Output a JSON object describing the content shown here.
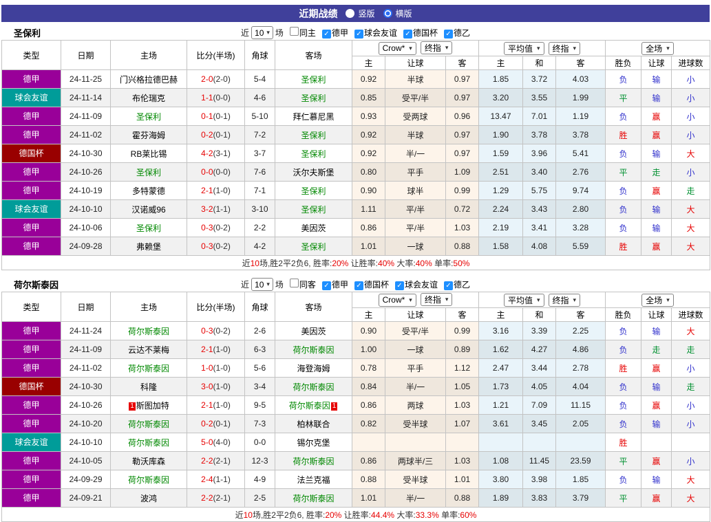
{
  "top_bar": {
    "title": "近期战绩",
    "radios": [
      {
        "label": "竖版",
        "selected": false
      },
      {
        "label": "横版",
        "selected": true
      }
    ]
  },
  "header": {
    "static_cols": [
      "类型",
      "日期",
      "主场",
      "比分(半场)",
      "角球",
      "客场"
    ],
    "group1_selects": [
      "Crow*",
      "终指"
    ],
    "group2_selects": [
      "平均值",
      "终指"
    ],
    "group3_selects": [
      "全场"
    ],
    "sub_cols": [
      "主",
      "让球",
      "客",
      "主",
      "和",
      "客",
      "胜负",
      "让球",
      "进球数"
    ],
    "caret": "▾",
    "check_glyph": "✓"
  },
  "colors": {
    "topbar": "#40409b",
    "league": {
      "purple": "#990099",
      "teal": "#009c99",
      "darkred": "#990000"
    },
    "team_green": "#008800",
    "score_red": "#e60000",
    "result": {
      "r": "#e60000",
      "b": "#3030cc",
      "g": "#009030"
    },
    "crow_bg": "#fdf4ea",
    "avg_bg": "#e9f4fa",
    "checkbox_blue": "#1e8fff",
    "radio_blue": "#2a6df4",
    "card_red": "#e60000"
  },
  "tables": [
    {
      "team": "圣保利",
      "filter": {
        "near_label": "近",
        "count": "10",
        "games_label": "场",
        "same_label": "同主",
        "same_checked": false,
        "leagues": [
          {
            "label": "德甲",
            "checked": true
          },
          {
            "label": "球会友谊",
            "checked": true
          },
          {
            "label": "德国杯",
            "checked": true
          },
          {
            "label": "德乙",
            "checked": true
          }
        ]
      },
      "rows": [
        {
          "league": "德甲",
          "lc": "purple",
          "date": "24-11-25",
          "home": "门兴格拉德巴赫",
          "home_team": false,
          "home_card": false,
          "score": "2-0",
          "half": "(2-0)",
          "corner": "5-4",
          "away": "圣保利",
          "away_team": true,
          "away_card": false,
          "odds": [
            "0.92",
            "半球",
            "0.97",
            "1.85",
            "3.72",
            "4.03"
          ],
          "res": [
            [
              "负",
              "b"
            ],
            [
              "输",
              "b"
            ],
            [
              "小",
              "b"
            ]
          ]
        },
        {
          "league": "球会友谊",
          "lc": "teal",
          "date": "24-11-14",
          "home": "布伦瑞克",
          "home_team": false,
          "home_card": false,
          "score": "1-1",
          "half": "(0-0)",
          "corner": "4-6",
          "away": "圣保利",
          "away_team": true,
          "away_card": false,
          "odds": [
            "0.85",
            "受平/半",
            "0.97",
            "3.20",
            "3.55",
            "1.99"
          ],
          "res": [
            [
              "平",
              "g"
            ],
            [
              "输",
              "b"
            ],
            [
              "小",
              "b"
            ]
          ]
        },
        {
          "league": "德甲",
          "lc": "purple",
          "date": "24-11-09",
          "home": "圣保利",
          "home_team": true,
          "home_card": false,
          "score": "0-1",
          "half": "(0-1)",
          "corner": "5-10",
          "away": "拜仁慕尼黑",
          "away_team": false,
          "away_card": false,
          "odds": [
            "0.93",
            "受两球",
            "0.96",
            "13.47",
            "7.01",
            "1.19"
          ],
          "res": [
            [
              "负",
              "b"
            ],
            [
              "赢",
              "r"
            ],
            [
              "小",
              "b"
            ]
          ]
        },
        {
          "league": "德甲",
          "lc": "purple",
          "date": "24-11-02",
          "home": "霍芬海姆",
          "home_team": false,
          "home_card": false,
          "score": "0-2",
          "half": "(0-1)",
          "corner": "7-2",
          "away": "圣保利",
          "away_team": true,
          "away_card": false,
          "odds": [
            "0.92",
            "半球",
            "0.97",
            "1.90",
            "3.78",
            "3.78"
          ],
          "res": [
            [
              "胜",
              "r"
            ],
            [
              "赢",
              "r"
            ],
            [
              "小",
              "b"
            ]
          ]
        },
        {
          "league": "德国杯",
          "lc": "darkred",
          "date": "24-10-30",
          "home": "RB莱比锡",
          "home_team": false,
          "home_card": false,
          "score": "4-2",
          "half": "(3-1)",
          "corner": "3-7",
          "away": "圣保利",
          "away_team": true,
          "away_card": false,
          "odds": [
            "0.92",
            "半/一",
            "0.97",
            "1.59",
            "3.96",
            "5.41"
          ],
          "res": [
            [
              "负",
              "b"
            ],
            [
              "输",
              "b"
            ],
            [
              "大",
              "r"
            ]
          ]
        },
        {
          "league": "德甲",
          "lc": "purple",
          "date": "24-10-26",
          "home": "圣保利",
          "home_team": true,
          "home_card": false,
          "score": "0-0",
          "half": "(0-0)",
          "corner": "7-6",
          "away": "沃尔夫斯堡",
          "away_team": false,
          "away_card": false,
          "odds": [
            "0.80",
            "平手",
            "1.09",
            "2.51",
            "3.40",
            "2.76"
          ],
          "res": [
            [
              "平",
              "g"
            ],
            [
              "走",
              "g"
            ],
            [
              "小",
              "b"
            ]
          ]
        },
        {
          "league": "德甲",
          "lc": "purple",
          "date": "24-10-19",
          "home": "多特蒙德",
          "home_team": false,
          "home_card": false,
          "score": "2-1",
          "half": "(1-0)",
          "corner": "7-1",
          "away": "圣保利",
          "away_team": true,
          "away_card": false,
          "odds": [
            "0.90",
            "球半",
            "0.99",
            "1.29",
            "5.75",
            "9.74"
          ],
          "res": [
            [
              "负",
              "b"
            ],
            [
              "赢",
              "r"
            ],
            [
              "走",
              "g"
            ]
          ]
        },
        {
          "league": "球会友谊",
          "lc": "teal",
          "date": "24-10-10",
          "home": "汉诺威96",
          "home_team": false,
          "home_card": false,
          "score": "3-2",
          "half": "(1-1)",
          "corner": "3-10",
          "away": "圣保利",
          "away_team": true,
          "away_card": false,
          "odds": [
            "1.11",
            "平/半",
            "0.72",
            "2.24",
            "3.43",
            "2.80"
          ],
          "res": [
            [
              "负",
              "b"
            ],
            [
              "输",
              "b"
            ],
            [
              "大",
              "r"
            ]
          ]
        },
        {
          "league": "德甲",
          "lc": "purple",
          "date": "24-10-06",
          "home": "圣保利",
          "home_team": true,
          "home_card": false,
          "score": "0-3",
          "half": "(0-2)",
          "corner": "2-2",
          "away": "美因茨",
          "away_team": false,
          "away_card": false,
          "odds": [
            "0.86",
            "平/半",
            "1.03",
            "2.19",
            "3.41",
            "3.28"
          ],
          "res": [
            [
              "负",
              "b"
            ],
            [
              "输",
              "b"
            ],
            [
              "大",
              "r"
            ]
          ]
        },
        {
          "league": "德甲",
          "lc": "purple",
          "date": "24-09-28",
          "home": "弗赖堡",
          "home_team": false,
          "home_card": false,
          "score": "0-3",
          "half": "(0-2)",
          "corner": "4-2",
          "away": "圣保利",
          "away_team": true,
          "away_card": false,
          "odds": [
            "1.01",
            "一球",
            "0.88",
            "1.58",
            "4.08",
            "5.59"
          ],
          "res": [
            [
              "胜",
              "r"
            ],
            [
              "赢",
              "r"
            ],
            [
              "大",
              "r"
            ]
          ]
        }
      ],
      "footer": [
        {
          "t": "近"
        },
        {
          "t": "10",
          "r": 1
        },
        {
          "t": "场,胜2平2负6, 胜率:"
        },
        {
          "t": "20%",
          "r": 1
        },
        {
          "t": " 让胜率:"
        },
        {
          "t": "40%",
          "r": 1
        },
        {
          "t": " 大率:"
        },
        {
          "t": "40%",
          "r": 1
        },
        {
          "t": " 单率:"
        },
        {
          "t": "50%",
          "r": 1
        }
      ]
    },
    {
      "team": "荷尔斯泰因",
      "filter": {
        "near_label": "近",
        "count": "10",
        "games_label": "场",
        "same_label": "同客",
        "same_checked": false,
        "leagues": [
          {
            "label": "德甲",
            "checked": true
          },
          {
            "label": "德国杯",
            "checked": true
          },
          {
            "label": "球会友谊",
            "checked": true
          },
          {
            "label": "德乙",
            "checked": true
          }
        ]
      },
      "rows": [
        {
          "league": "德甲",
          "lc": "purple",
          "date": "24-11-24",
          "home": "荷尔斯泰因",
          "home_team": true,
          "home_card": false,
          "score": "0-3",
          "half": "(0-2)",
          "corner": "2-6",
          "away": "美因茨",
          "away_team": false,
          "away_card": false,
          "odds": [
            "0.90",
            "受平/半",
            "0.99",
            "3.16",
            "3.39",
            "2.25"
          ],
          "res": [
            [
              "负",
              "b"
            ],
            [
              "输",
              "b"
            ],
            [
              "大",
              "r"
            ]
          ]
        },
        {
          "league": "德甲",
          "lc": "purple",
          "date": "24-11-09",
          "home": "云达不莱梅",
          "home_team": false,
          "home_card": false,
          "score": "2-1",
          "half": "(1-0)",
          "corner": "6-3",
          "away": "荷尔斯泰因",
          "away_team": true,
          "away_card": false,
          "odds": [
            "1.00",
            "一球",
            "0.89",
            "1.62",
            "4.27",
            "4.86"
          ],
          "res": [
            [
              "负",
              "b"
            ],
            [
              "走",
              "g"
            ],
            [
              "走",
              "g"
            ]
          ]
        },
        {
          "league": "德甲",
          "lc": "purple",
          "date": "24-11-02",
          "home": "荷尔斯泰因",
          "home_team": true,
          "home_card": false,
          "score": "1-0",
          "half": "(1-0)",
          "corner": "5-6",
          "away": "海登海姆",
          "away_team": false,
          "away_card": false,
          "odds": [
            "0.78",
            "平手",
            "1.12",
            "2.47",
            "3.44",
            "2.78"
          ],
          "res": [
            [
              "胜",
              "r"
            ],
            [
              "赢",
              "r"
            ],
            [
              "小",
              "b"
            ]
          ]
        },
        {
          "league": "德国杯",
          "lc": "darkred",
          "date": "24-10-30",
          "home": "科隆",
          "home_team": false,
          "home_card": false,
          "score": "3-0",
          "half": "(1-0)",
          "corner": "3-4",
          "away": "荷尔斯泰因",
          "away_team": true,
          "away_card": false,
          "odds": [
            "0.84",
            "半/一",
            "1.05",
            "1.73",
            "4.05",
            "4.04"
          ],
          "res": [
            [
              "负",
              "b"
            ],
            [
              "输",
              "b"
            ],
            [
              "走",
              "g"
            ]
          ]
        },
        {
          "league": "德甲",
          "lc": "purple",
          "date": "24-10-26",
          "home": "斯图加特",
          "home_team": false,
          "home_card": true,
          "score": "2-1",
          "half": "(1-0)",
          "corner": "9-5",
          "away": "荷尔斯泰因",
          "away_team": true,
          "away_card": true,
          "odds": [
            "0.86",
            "两球",
            "1.03",
            "1.21",
            "7.09",
            "11.15"
          ],
          "res": [
            [
              "负",
              "b"
            ],
            [
              "赢",
              "r"
            ],
            [
              "小",
              "b"
            ]
          ]
        },
        {
          "league": "德甲",
          "lc": "purple",
          "date": "24-10-20",
          "home": "荷尔斯泰因",
          "home_team": true,
          "home_card": false,
          "score": "0-2",
          "half": "(0-1)",
          "corner": "7-3",
          "away": "柏林联合",
          "away_team": false,
          "away_card": false,
          "odds": [
            "0.82",
            "受半球",
            "1.07",
            "3.61",
            "3.45",
            "2.05"
          ],
          "res": [
            [
              "负",
              "b"
            ],
            [
              "输",
              "b"
            ],
            [
              "小",
              "b"
            ]
          ]
        },
        {
          "league": "球会友谊",
          "lc": "teal",
          "date": "24-10-10",
          "home": "荷尔斯泰因",
          "home_team": true,
          "home_card": false,
          "score": "5-0",
          "half": "(4-0)",
          "corner": "0-0",
          "away": "锡尔克堡",
          "away_team": false,
          "away_card": false,
          "odds": [
            "",
            "",
            "",
            "",
            "",
            ""
          ],
          "res": [
            [
              "胜",
              "r"
            ],
            [
              "",
              ""
            ],
            [
              "",
              ""
            ]
          ]
        },
        {
          "league": "德甲",
          "lc": "purple",
          "date": "24-10-05",
          "home": "勒沃库森",
          "home_team": false,
          "home_card": false,
          "score": "2-2",
          "half": "(2-1)",
          "corner": "12-3",
          "away": "荷尔斯泰因",
          "away_team": true,
          "away_card": false,
          "odds": [
            "0.86",
            "两球半/三",
            "1.03",
            "1.08",
            "11.45",
            "23.59"
          ],
          "res": [
            [
              "平",
              "g"
            ],
            [
              "赢",
              "r"
            ],
            [
              "小",
              "b"
            ]
          ]
        },
        {
          "league": "德甲",
          "lc": "purple",
          "date": "24-09-29",
          "home": "荷尔斯泰因",
          "home_team": true,
          "home_card": false,
          "score": "2-4",
          "half": "(1-1)",
          "corner": "4-9",
          "away": "法兰克福",
          "away_team": false,
          "away_card": false,
          "odds": [
            "0.88",
            "受半球",
            "1.01",
            "3.80",
            "3.98",
            "1.85"
          ],
          "res": [
            [
              "负",
              "b"
            ],
            [
              "输",
              "b"
            ],
            [
              "大",
              "r"
            ]
          ]
        },
        {
          "league": "德甲",
          "lc": "purple",
          "date": "24-09-21",
          "home": "波鸿",
          "home_team": false,
          "home_card": false,
          "score": "2-2",
          "half": "(2-1)",
          "corner": "2-5",
          "away": "荷尔斯泰因",
          "away_team": true,
          "away_card": false,
          "odds": [
            "1.01",
            "半/一",
            "0.88",
            "1.89",
            "3.83",
            "3.79"
          ],
          "res": [
            [
              "平",
              "g"
            ],
            [
              "赢",
              "r"
            ],
            [
              "大",
              "r"
            ]
          ]
        }
      ],
      "footer": [
        {
          "t": "近"
        },
        {
          "t": "10",
          "r": 1
        },
        {
          "t": "场,胜2平2负6, 胜率:"
        },
        {
          "t": "20%",
          "r": 1
        },
        {
          "t": " 让胜率:"
        },
        {
          "t": "44.4%",
          "r": 1
        },
        {
          "t": " 大率:"
        },
        {
          "t": "33.3%",
          "r": 1
        },
        {
          "t": " 单率:"
        },
        {
          "t": "60%",
          "r": 1
        }
      ]
    }
  ]
}
